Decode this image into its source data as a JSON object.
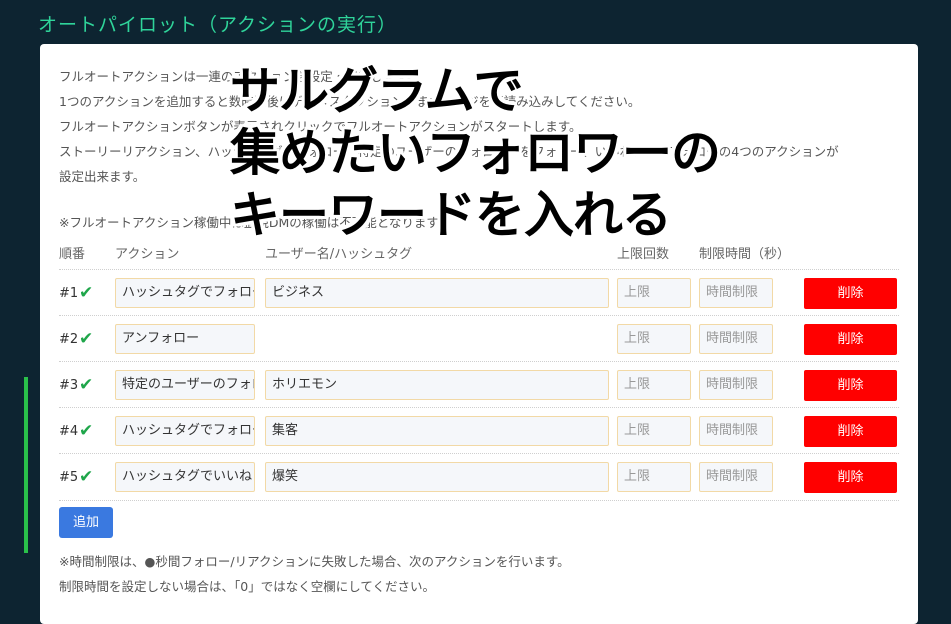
{
  "header": {
    "title": "オートパイロット（アクションの実行）"
  },
  "info": {
    "lines": [
      "フルオートアクションは一連のアクションを設定・実行します。",
      "1つのアクションを追加すると数時間後にデータスタクションがまたページを再読み込みしてください。",
      "フルオートアクションボタンが表示されクリックでフルオートアクションがスタートします。",
      "ストーリーリアクション、ハッシュタグでフォロー、特定のユーザーのフォロワーをフォロー、いいね、アンフォローの4つのアクションが",
      "設定出来ます。"
    ],
    "note": "※フルオートアクション稼働中は監視DMの稼働は不可能となります。"
  },
  "table": {
    "headers": {
      "order": "順番",
      "action": "アクション",
      "user": "ユーザー名/ハッシュタグ",
      "limit": "上限回数",
      "time": "制限時間（秒）"
    },
    "rows": [
      {
        "num": "#1",
        "action": "ハッシュタグでフォロー",
        "user": "ビジネス",
        "limit_ph": "上限",
        "time_ph": "時間制限",
        "delete": "削除"
      },
      {
        "num": "#2",
        "action": "アンフォロー",
        "user": "",
        "limit_ph": "上限",
        "time_ph": "時間制限",
        "delete": "削除"
      },
      {
        "num": "#3",
        "action": "特定のユーザーのフォロワー",
        "user": "ホリエモン",
        "limit_ph": "上限",
        "time_ph": "時間制限",
        "delete": "削除"
      },
      {
        "num": "#4",
        "action": "ハッシュタグでフォロー",
        "user": "集客",
        "limit_ph": "上限",
        "time_ph": "時間制限",
        "delete": "削除"
      },
      {
        "num": "#5",
        "action": "ハッシュタグでいいね",
        "user": "爆笑",
        "limit_ph": "上限",
        "time_ph": "時間制限",
        "delete": "削除"
      }
    ]
  },
  "add_button": "追加",
  "footer": {
    "line1": "※時間制限は、●秒間フォロー/リアクションに失敗した場合、次のアクションを行います。",
    "line2": "制限時間を設定しない場合は、「0」ではなく空欄にしてください。"
  },
  "overlay": {
    "line1": "サルグラムで",
    "line2": "集めたいフォロワーの",
    "line3": "キーワードを入れる"
  },
  "icons": {
    "check": "check-icon"
  },
  "colors": {
    "accent": "#2fd49a",
    "delete": "#ff0000",
    "add": "#3a79e0",
    "check": "#1fa64a"
  }
}
